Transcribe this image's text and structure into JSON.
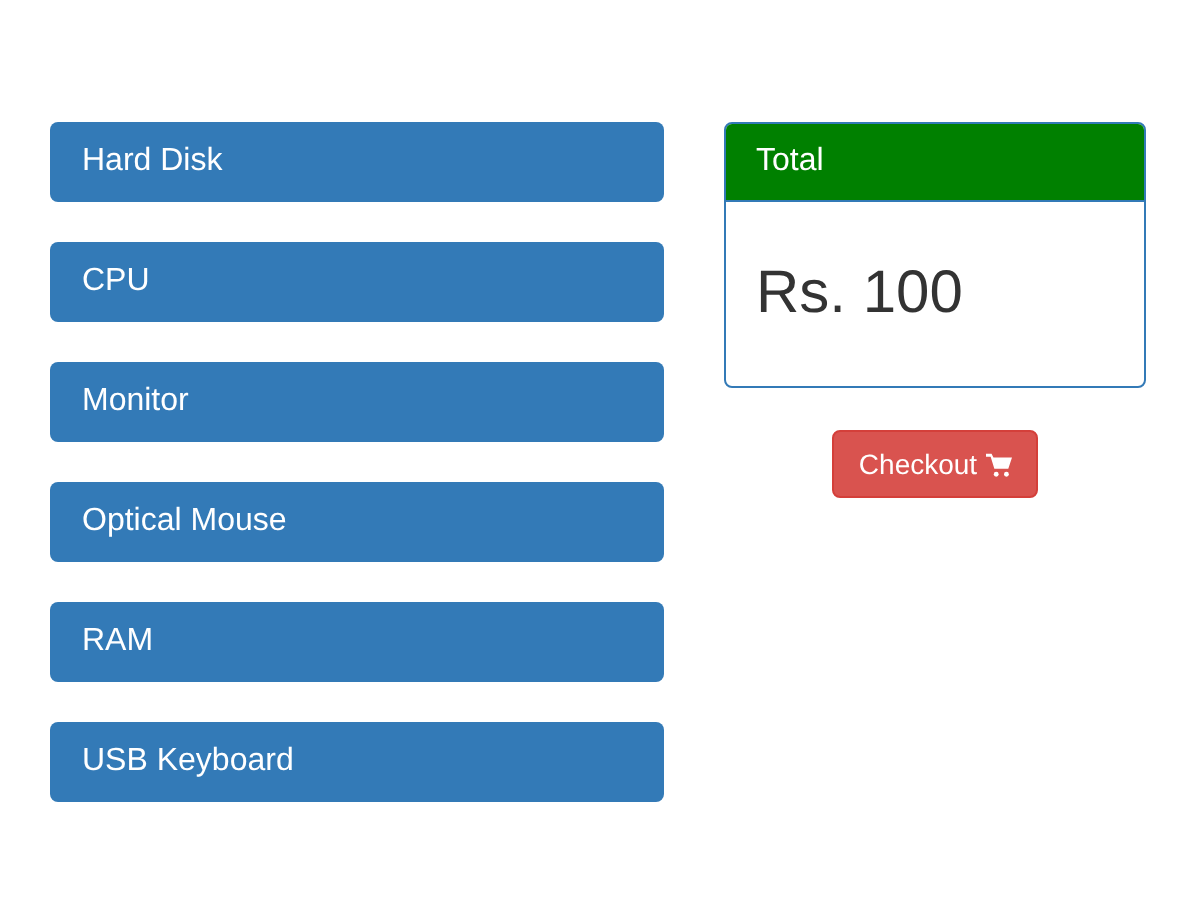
{
  "products": [
    {
      "name": "Hard Disk"
    },
    {
      "name": "CPU"
    },
    {
      "name": "Monitor"
    },
    {
      "name": "Optical Mouse"
    },
    {
      "name": "RAM"
    },
    {
      "name": "USB Keyboard"
    }
  ],
  "total": {
    "heading": "Total",
    "amount": "Rs. 100"
  },
  "checkout": {
    "label": "Checkout"
  }
}
